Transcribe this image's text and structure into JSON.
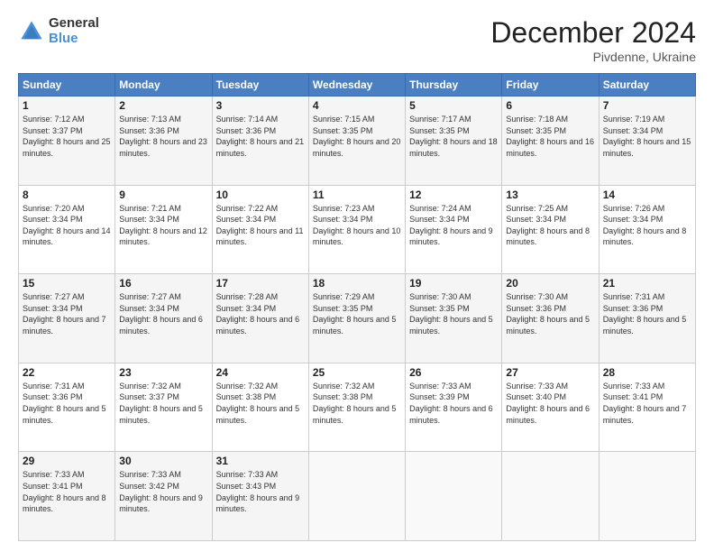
{
  "logo": {
    "general": "General",
    "blue": "Blue"
  },
  "header": {
    "month": "December 2024",
    "location": "Pivdenne, Ukraine"
  },
  "weekdays": [
    "Sunday",
    "Monday",
    "Tuesday",
    "Wednesday",
    "Thursday",
    "Friday",
    "Saturday"
  ],
  "weeks": [
    [
      {
        "day": "1",
        "sunrise": "7:12 AM",
        "sunset": "3:37 PM",
        "daylight": "8 hours and 25 minutes."
      },
      {
        "day": "2",
        "sunrise": "7:13 AM",
        "sunset": "3:36 PM",
        "daylight": "8 hours and 23 minutes."
      },
      {
        "day": "3",
        "sunrise": "7:14 AM",
        "sunset": "3:36 PM",
        "daylight": "8 hours and 21 minutes."
      },
      {
        "day": "4",
        "sunrise": "7:15 AM",
        "sunset": "3:35 PM",
        "daylight": "8 hours and 20 minutes."
      },
      {
        "day": "5",
        "sunrise": "7:17 AM",
        "sunset": "3:35 PM",
        "daylight": "8 hours and 18 minutes."
      },
      {
        "day": "6",
        "sunrise": "7:18 AM",
        "sunset": "3:35 PM",
        "daylight": "8 hours and 16 minutes."
      },
      {
        "day": "7",
        "sunrise": "7:19 AM",
        "sunset": "3:34 PM",
        "daylight": "8 hours and 15 minutes."
      }
    ],
    [
      {
        "day": "8",
        "sunrise": "7:20 AM",
        "sunset": "3:34 PM",
        "daylight": "8 hours and 14 minutes."
      },
      {
        "day": "9",
        "sunrise": "7:21 AM",
        "sunset": "3:34 PM",
        "daylight": "8 hours and 12 minutes."
      },
      {
        "day": "10",
        "sunrise": "7:22 AM",
        "sunset": "3:34 PM",
        "daylight": "8 hours and 11 minutes."
      },
      {
        "day": "11",
        "sunrise": "7:23 AM",
        "sunset": "3:34 PM",
        "daylight": "8 hours and 10 minutes."
      },
      {
        "day": "12",
        "sunrise": "7:24 AM",
        "sunset": "3:34 PM",
        "daylight": "8 hours and 9 minutes."
      },
      {
        "day": "13",
        "sunrise": "7:25 AM",
        "sunset": "3:34 PM",
        "daylight": "8 hours and 8 minutes."
      },
      {
        "day": "14",
        "sunrise": "7:26 AM",
        "sunset": "3:34 PM",
        "daylight": "8 hours and 8 minutes."
      }
    ],
    [
      {
        "day": "15",
        "sunrise": "7:27 AM",
        "sunset": "3:34 PM",
        "daylight": "8 hours and 7 minutes."
      },
      {
        "day": "16",
        "sunrise": "7:27 AM",
        "sunset": "3:34 PM",
        "daylight": "8 hours and 6 minutes."
      },
      {
        "day": "17",
        "sunrise": "7:28 AM",
        "sunset": "3:34 PM",
        "daylight": "8 hours and 6 minutes."
      },
      {
        "day": "18",
        "sunrise": "7:29 AM",
        "sunset": "3:35 PM",
        "daylight": "8 hours and 5 minutes."
      },
      {
        "day": "19",
        "sunrise": "7:30 AM",
        "sunset": "3:35 PM",
        "daylight": "8 hours and 5 minutes."
      },
      {
        "day": "20",
        "sunrise": "7:30 AM",
        "sunset": "3:36 PM",
        "daylight": "8 hours and 5 minutes."
      },
      {
        "day": "21",
        "sunrise": "7:31 AM",
        "sunset": "3:36 PM",
        "daylight": "8 hours and 5 minutes."
      }
    ],
    [
      {
        "day": "22",
        "sunrise": "7:31 AM",
        "sunset": "3:36 PM",
        "daylight": "8 hours and 5 minutes."
      },
      {
        "day": "23",
        "sunrise": "7:32 AM",
        "sunset": "3:37 PM",
        "daylight": "8 hours and 5 minutes."
      },
      {
        "day": "24",
        "sunrise": "7:32 AM",
        "sunset": "3:38 PM",
        "daylight": "8 hours and 5 minutes."
      },
      {
        "day": "25",
        "sunrise": "7:32 AM",
        "sunset": "3:38 PM",
        "daylight": "8 hours and 5 minutes."
      },
      {
        "day": "26",
        "sunrise": "7:33 AM",
        "sunset": "3:39 PM",
        "daylight": "8 hours and 6 minutes."
      },
      {
        "day": "27",
        "sunrise": "7:33 AM",
        "sunset": "3:40 PM",
        "daylight": "8 hours and 6 minutes."
      },
      {
        "day": "28",
        "sunrise": "7:33 AM",
        "sunset": "3:41 PM",
        "daylight": "8 hours and 7 minutes."
      }
    ],
    [
      {
        "day": "29",
        "sunrise": "7:33 AM",
        "sunset": "3:41 PM",
        "daylight": "8 hours and 8 minutes."
      },
      {
        "day": "30",
        "sunrise": "7:33 AM",
        "sunset": "3:42 PM",
        "daylight": "8 hours and 9 minutes."
      },
      {
        "day": "31",
        "sunrise": "7:33 AM",
        "sunset": "3:43 PM",
        "daylight": "8 hours and 9 minutes."
      },
      null,
      null,
      null,
      null
    ]
  ],
  "labels": {
    "sunrise": "Sunrise:",
    "sunset": "Sunset:",
    "daylight": "Daylight:"
  }
}
